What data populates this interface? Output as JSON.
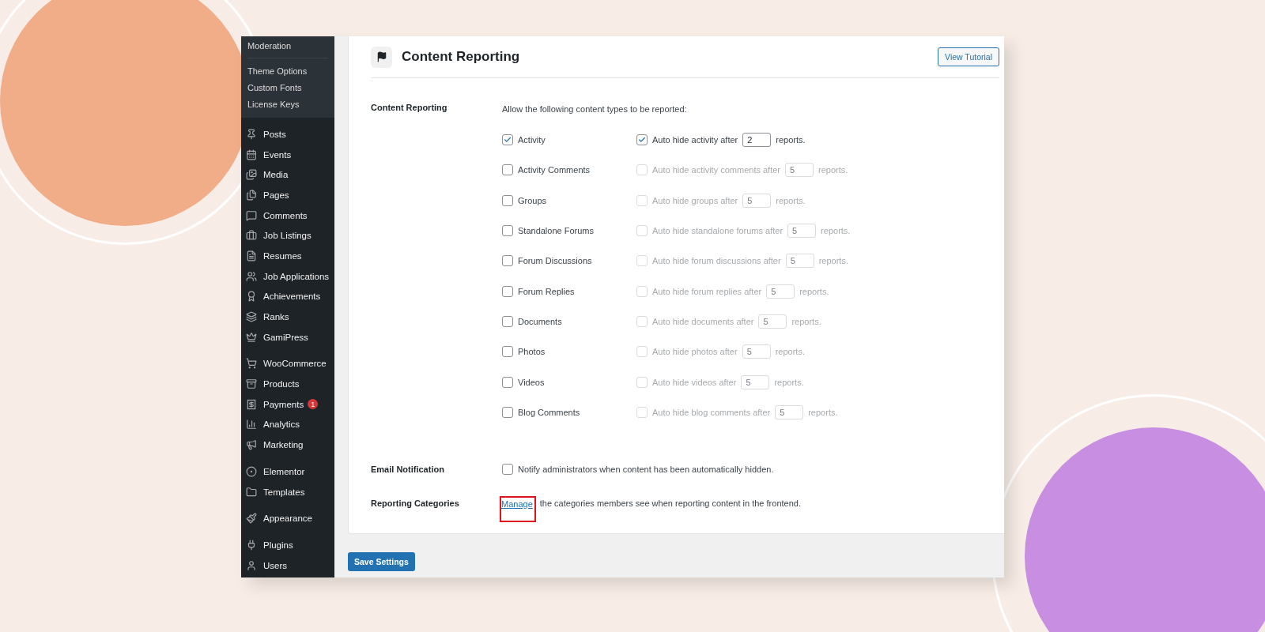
{
  "sidebar": {
    "submenu": [
      {
        "label": "Moderation"
      },
      {
        "label": "Theme Options"
      },
      {
        "label": "Custom Fonts"
      },
      {
        "label": "License Keys"
      }
    ],
    "groups": [
      {
        "items": [
          {
            "label": "Posts"
          },
          {
            "label": "Events"
          },
          {
            "label": "Media"
          },
          {
            "label": "Pages"
          },
          {
            "label": "Comments"
          },
          {
            "label": "Job Listings"
          },
          {
            "label": "Resumes"
          },
          {
            "label": "Job Applications"
          },
          {
            "label": "Achievements"
          },
          {
            "label": "Ranks"
          },
          {
            "label": "GamiPress"
          }
        ]
      },
      {
        "items": [
          {
            "label": "WooCommerce"
          },
          {
            "label": "Products"
          },
          {
            "label": "Payments",
            "badge": "1"
          },
          {
            "label": "Analytics"
          },
          {
            "label": "Marketing"
          }
        ]
      },
      {
        "items": [
          {
            "label": "Elementor"
          },
          {
            "label": "Templates"
          }
        ]
      },
      {
        "items": [
          {
            "label": "Appearance"
          }
        ]
      },
      {
        "items": [
          {
            "label": "Plugins"
          },
          {
            "label": "Users"
          }
        ]
      }
    ]
  },
  "page": {
    "title": "Content Reporting",
    "tutorial_button": "View Tutorial"
  },
  "content_reporting": {
    "label": "Content Reporting",
    "intro": "Allow the following content types to be reported:",
    "types": [
      {
        "label": "Activity",
        "checked": true,
        "auto_hide": {
          "checked": true,
          "disabled": false,
          "before": "Auto hide activity after",
          "value": "2",
          "after": "reports."
        }
      },
      {
        "label": "Activity Comments",
        "checked": false,
        "auto_hide": {
          "checked": false,
          "disabled": true,
          "before": "Auto hide activity comments after",
          "value": "5",
          "after": "reports."
        }
      },
      {
        "label": "Groups",
        "checked": false,
        "auto_hide": {
          "checked": false,
          "disabled": true,
          "before": "Auto hide groups after",
          "value": "5",
          "after": "reports."
        }
      },
      {
        "label": "Standalone Forums",
        "checked": false,
        "auto_hide": {
          "checked": false,
          "disabled": true,
          "before": "Auto hide standalone forums after",
          "value": "5",
          "after": "reports."
        }
      },
      {
        "label": "Forum Discussions",
        "checked": false,
        "auto_hide": {
          "checked": false,
          "disabled": true,
          "before": "Auto hide forum discussions after",
          "value": "5",
          "after": "reports."
        }
      },
      {
        "label": "Forum Replies",
        "checked": false,
        "auto_hide": {
          "checked": false,
          "disabled": true,
          "before": "Auto hide forum replies after",
          "value": "5",
          "after": "reports."
        }
      },
      {
        "label": "Documents",
        "checked": false,
        "auto_hide": {
          "checked": false,
          "disabled": true,
          "before": "Auto hide documents after",
          "value": "5",
          "after": "reports."
        }
      },
      {
        "label": "Photos",
        "checked": false,
        "auto_hide": {
          "checked": false,
          "disabled": true,
          "before": "Auto hide photos after",
          "value": "5",
          "after": "reports."
        }
      },
      {
        "label": "Videos",
        "checked": false,
        "auto_hide": {
          "checked": false,
          "disabled": true,
          "before": "Auto hide videos after",
          "value": "5",
          "after": "reports."
        }
      },
      {
        "label": "Blog Comments",
        "checked": false,
        "auto_hide": {
          "checked": false,
          "disabled": true,
          "before": "Auto hide blog comments after",
          "value": "5",
          "after": "reports."
        }
      }
    ]
  },
  "email_notification": {
    "label": "Email Notification",
    "checked": false,
    "text": "Notify administrators when content has been automatically hidden."
  },
  "reporting_categories": {
    "label": "Reporting Categories",
    "link": "Manage",
    "highlighted": true,
    "text": "the categories members see when reporting content in the frontend."
  },
  "save_button": "Save Settings"
}
